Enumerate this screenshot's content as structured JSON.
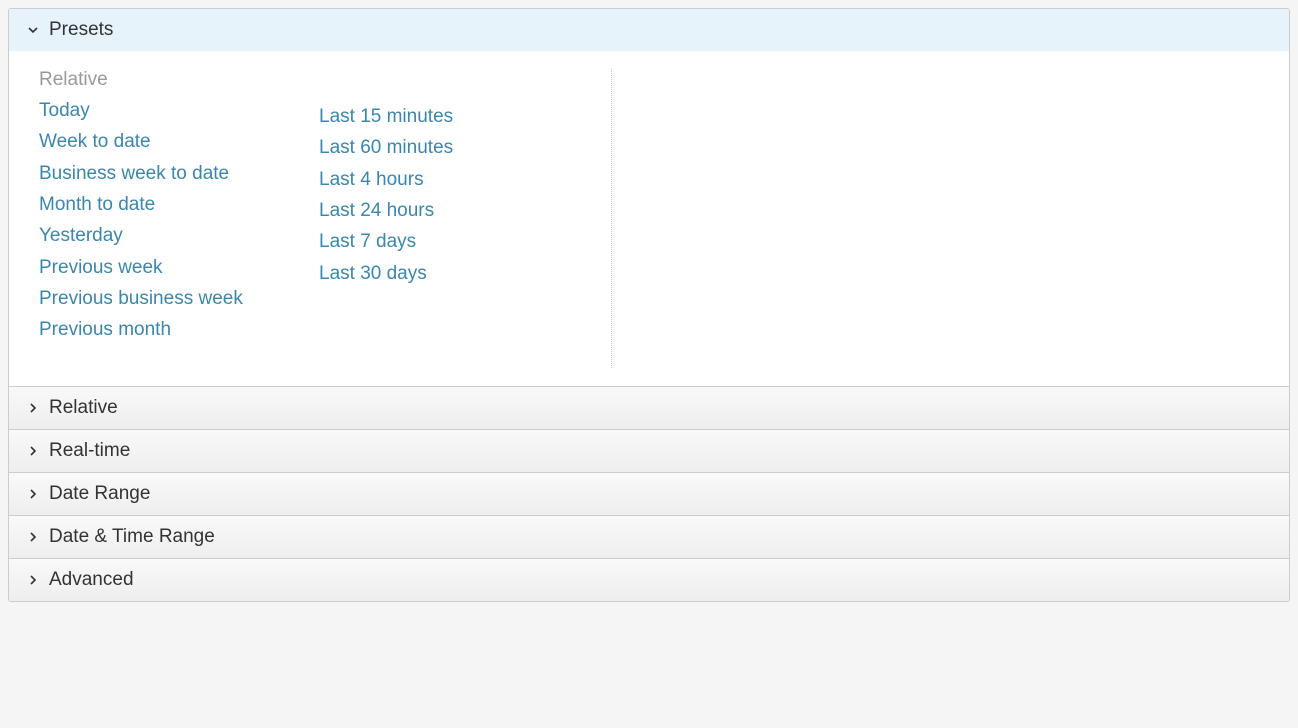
{
  "sections": {
    "presets": {
      "title": "Presets",
      "expanded": true
    },
    "relative": {
      "title": "Relative",
      "expanded": false
    },
    "realtime": {
      "title": "Real-time",
      "expanded": false
    },
    "daterange": {
      "title": "Date Range",
      "expanded": false
    },
    "datetimerange": {
      "title": "Date & Time Range",
      "expanded": false
    },
    "advanced": {
      "title": "Advanced",
      "expanded": false
    }
  },
  "presets": {
    "group_label": "Relative",
    "col1": [
      "Today",
      "Week to date",
      "Business week to date",
      "Month to date",
      "Yesterday",
      "Previous week",
      "Previous business week",
      "Previous month"
    ],
    "col2": [
      "Last 15 minutes",
      "Last 60 minutes",
      "Last 4 hours",
      "Last 24 hours",
      "Last 7 days",
      "Last 30 days"
    ]
  }
}
